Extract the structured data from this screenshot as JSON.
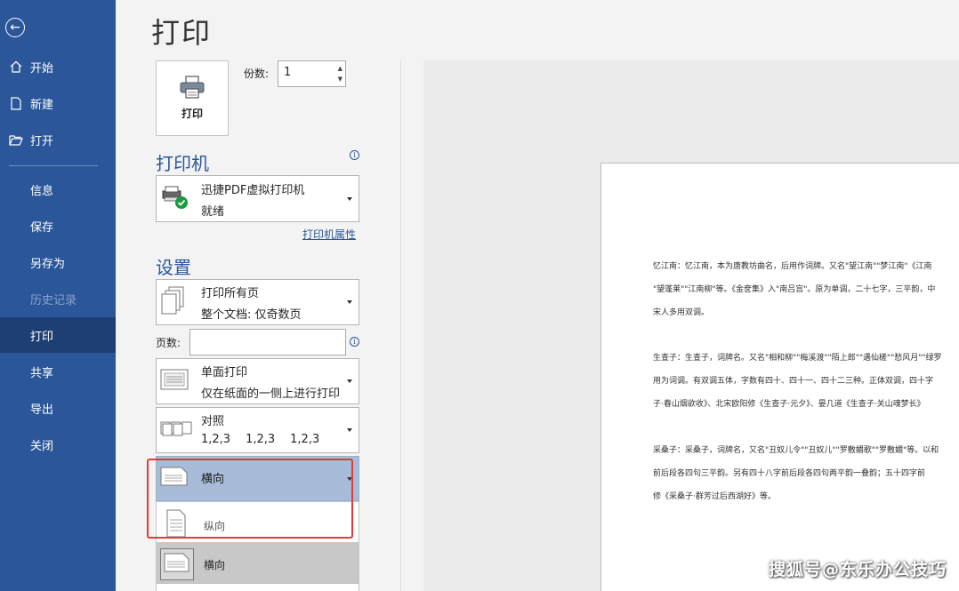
{
  "sidebar": {
    "back_icon": "arrow-left-circle-icon",
    "items": [
      {
        "label": "开始",
        "icon": "home-icon"
      },
      {
        "label": "新建",
        "icon": "new-doc-icon"
      },
      {
        "label": "打开",
        "icon": "folder-open-icon"
      },
      {
        "label": "信息"
      },
      {
        "label": "保存"
      },
      {
        "label": "另存为"
      },
      {
        "label": "历史记录",
        "disabled": true
      },
      {
        "label": "打印",
        "active": true
      },
      {
        "label": "共享"
      },
      {
        "label": "导出"
      },
      {
        "label": "关闭"
      }
    ]
  },
  "page_title": "打印",
  "print_button": {
    "label": "打印",
    "icon": "printer-icon"
  },
  "copies": {
    "label": "份数:",
    "value": "1"
  },
  "printer_section": {
    "title": "打印机",
    "name": "迅捷PDF虚拟打印机",
    "status": "就绪",
    "properties_link": "打印机属性"
  },
  "settings_section": {
    "title": "设置",
    "print_range": {
      "line1": "打印所有页",
      "line2": "整个文档: 仅奇数页"
    },
    "pages": {
      "label": "页数:",
      "value": ""
    },
    "sides": {
      "line1": "单面打印",
      "line2": "仅在纸面的一侧上进行打印"
    },
    "collate": {
      "line1": "对照",
      "nums": [
        "1,2,3",
        "1,2,3",
        "1,2,3"
      ]
    },
    "orientation": {
      "selected": "横向",
      "options": [
        "纵向",
        "横向"
      ]
    }
  },
  "preview": {
    "lines": [
      "忆江南：忆江南，本为唐教坊曲名，后用作词牌。又名\"望江南\"\"梦江南\"《江南",
      "\"望蓬莱\"\"江南柳\"等。《金奁集》入\"南吕宫\"。原为单调，二十七字，三平韵，中",
      "宋人多用双调。",
      "生查子：生查子，词牌名。又名\"相和柳\"\"梅溪渡\"\"陌上郎\"\"遇仙槎\"\"愁风月\"\"绿罗",
      "用为词调。有双调五体，字数有四十、四十一、四十二三种。正体双调，四十字",
      "子·春山烟欲收》、北宋欧阳修《生查子·元夕》、晏几道《生查子·关山魂梦长》",
      "采桑子：采桑子，词牌名，又名\"丑奴儿令\"\"丑奴儿\"\"罗敷媚歌\"\"罗敷媚\"等。以和",
      "前后段各四句三平韵。另有四十八字前后段各四句两平韵一叠韵；五十四字前",
      "修《采桑子·群芳过后西湖好》等。"
    ]
  },
  "watermark": "搜狐号@东乐办公技巧"
}
